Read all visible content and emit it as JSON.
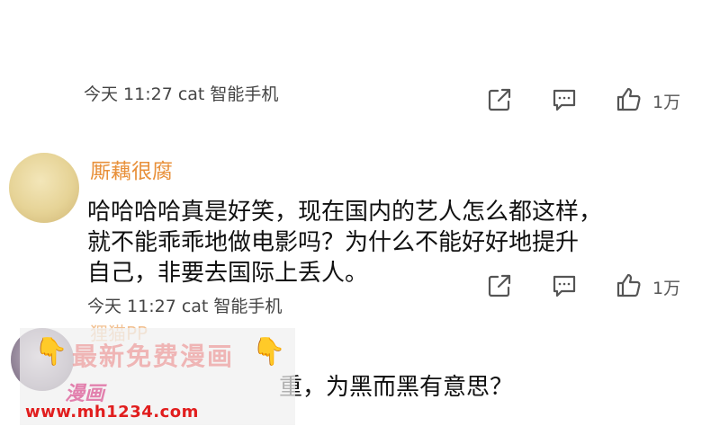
{
  "comments": [
    {
      "meta": "今天 11:27 cat 智能手机",
      "like_count": "1万"
    },
    {
      "username": "厮藕很腐",
      "text_lines": [
        "哈哈哈哈真是好笑，现在国内的艺人怎么都这样，",
        "就不能乖乖地做电影吗？为什么不能好好地提升",
        "自己，非要去国际上丢人。"
      ],
      "meta": "今天 11:27 cat 智能手机",
      "like_count": "1万"
    },
    {
      "username": "狸猫PP",
      "text_partial": "重，为黑而黑有意思？"
    }
  ],
  "watermark": {
    "title": "最新免费漫画",
    "url": "www.mh1234.com",
    "logo_text": "漫画"
  },
  "icons": [
    "share-icon",
    "comment-icon",
    "thumbs-up-icon",
    "pointing-hand-icon"
  ],
  "colors": {
    "username": "#e8903a",
    "meta": "#444444",
    "watermark_url": "#e11e1e"
  }
}
